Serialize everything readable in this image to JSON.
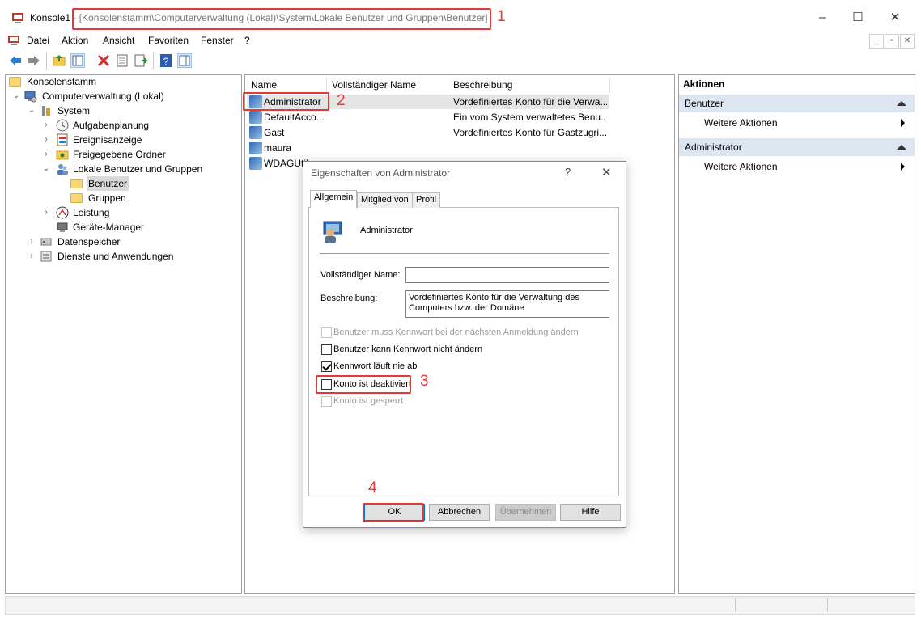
{
  "window": {
    "app_name": "Konsole1",
    "separator": " - ",
    "path": "[Konsolenstamm\\Computerverwaltung (Lokal)\\System\\Lokale Benutzer und Gruppen\\Benutzer]",
    "controls": [
      "–",
      "☐",
      "✕"
    ]
  },
  "menu": [
    "Datei",
    "Aktion",
    "Ansicht",
    "Favoriten",
    "Fenster",
    "?"
  ],
  "mdi_controls": [
    "_",
    "▫",
    "✕"
  ],
  "tree": [
    {
      "label": "Konsolenstamm",
      "level": 0
    },
    {
      "label": "Computerverwaltung (Lokal)",
      "level": 1,
      "expanded": true
    },
    {
      "label": "System",
      "level": 2,
      "expanded": true
    },
    {
      "label": "Aufgabenplanung",
      "level": 3,
      "expanded": false
    },
    {
      "label": "Ereignisanzeige",
      "level": 3,
      "expanded": false
    },
    {
      "label": "Freigegebene Ordner",
      "level": 3,
      "expanded": false
    },
    {
      "label": "Lokale Benutzer und Gruppen",
      "level": 3,
      "expanded": true
    },
    {
      "label": "Benutzer",
      "level": 4,
      "selected": true
    },
    {
      "label": "Gruppen",
      "level": 4
    },
    {
      "label": "Leistung",
      "level": 3,
      "expanded": false
    },
    {
      "label": "Geräte-Manager",
      "level": 3
    },
    {
      "label": "Datenspeicher",
      "level": 2,
      "expanded": false
    },
    {
      "label": "Dienste und Anwendungen",
      "level": 2,
      "expanded": false
    }
  ],
  "list": {
    "columns": [
      "Name",
      "Vollständiger Name",
      "Beschreibung"
    ],
    "rows": [
      {
        "name": "Administrator",
        "full": "",
        "desc": "Vordefiniertes Konto für die Verwa..."
      },
      {
        "name": "DefaultAcco...",
        "full": "",
        "desc": "Ein vom System verwaltetes Benu..."
      },
      {
        "name": "Gast",
        "full": "",
        "desc": "Vordefiniertes Konto für Gastzugri..."
      },
      {
        "name": "maura",
        "full": "",
        "desc": ""
      },
      {
        "name": "WDAGUtil",
        "full": "",
        "desc": ""
      }
    ]
  },
  "actions": {
    "title": "Aktionen",
    "sections": [
      {
        "header": "Benutzer",
        "item": "Weitere Aktionen"
      },
      {
        "header": "Administrator",
        "item": "Weitere Aktionen"
      }
    ]
  },
  "dialog": {
    "title": "Eigenschaften von Administrator",
    "help": "?",
    "close": "✕",
    "tabs": [
      "Allgemein",
      "Mitglied von",
      "Profil"
    ],
    "user_name": "Administrator",
    "full_name_label": "Vollständiger Name:",
    "full_name_value": "",
    "description_label": "Beschreibung:",
    "description_value": "Vordefiniertes Konto für die Verwaltung des Computers bzw. der Domäne",
    "checkboxes": [
      {
        "label": "Benutzer muss Kennwort bei der nächsten Anmeldung ändern",
        "checked": false,
        "disabled": true
      },
      {
        "label": "Benutzer kann Kennwort nicht ändern",
        "checked": false,
        "disabled": false
      },
      {
        "label": "Kennwort läuft nie ab",
        "checked": true,
        "disabled": false
      },
      {
        "label": "Konto ist deaktiviert",
        "checked": false,
        "disabled": false
      },
      {
        "label": "Konto ist gesperrt",
        "checked": false,
        "disabled": true
      }
    ],
    "buttons": [
      "OK",
      "Abbrechen",
      "Übernehmen",
      "Hilfe"
    ]
  },
  "annotations": [
    "1",
    "2",
    "3",
    "4"
  ],
  "colors": {
    "highlight": "#e53935",
    "selection": "#e5e5e5",
    "action_header": "#dce6f1"
  }
}
